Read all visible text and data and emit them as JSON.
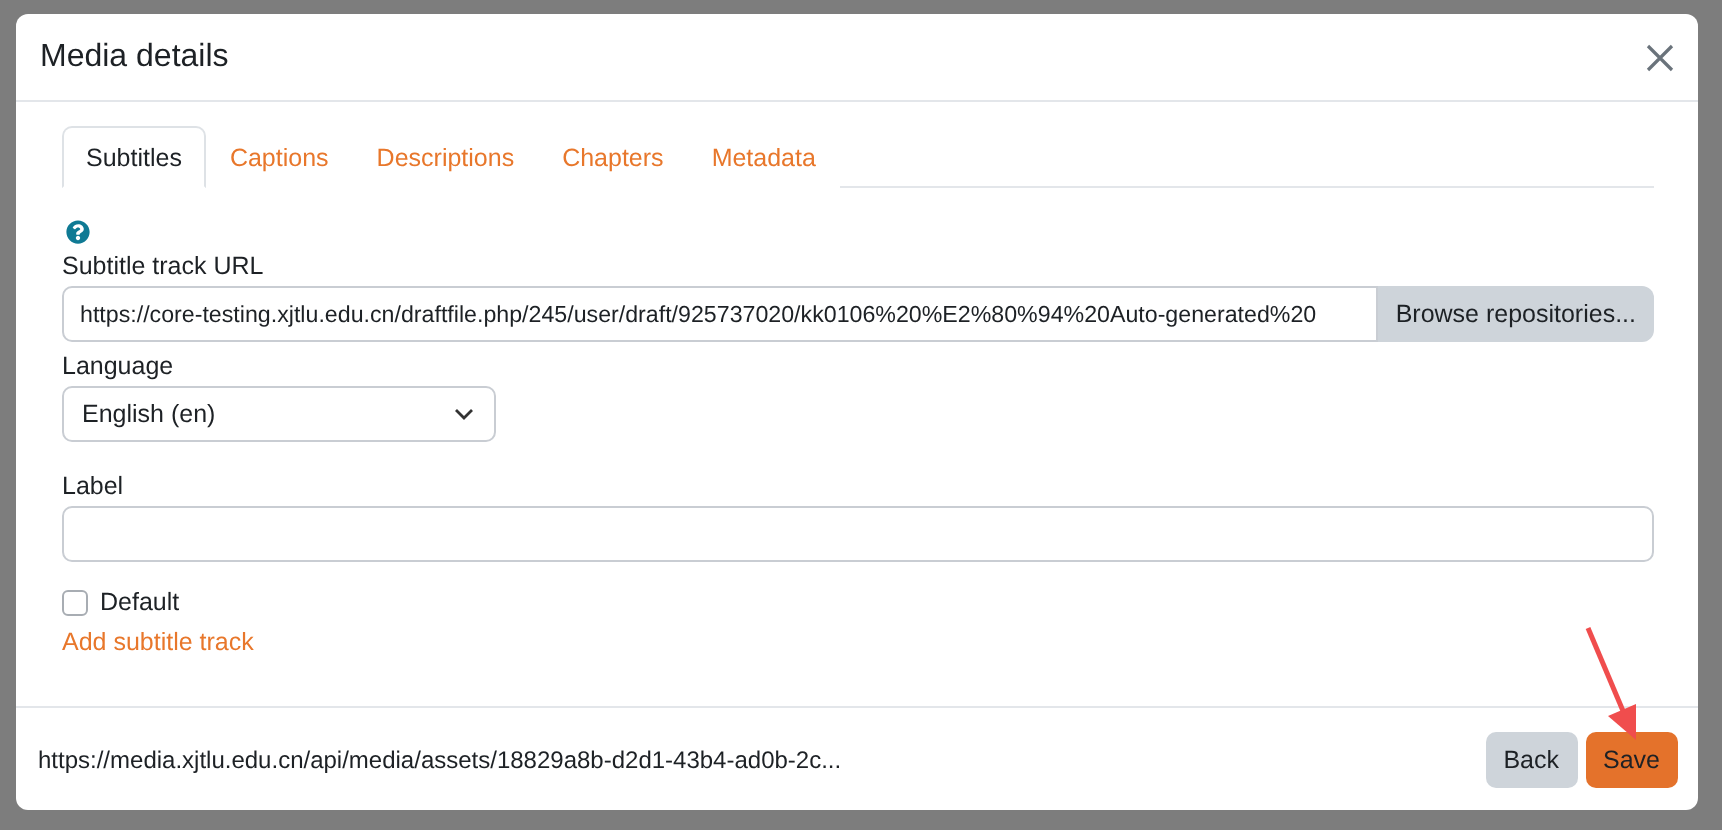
{
  "dialog": {
    "title": "Media details"
  },
  "tabs": [
    {
      "label": "Subtitles",
      "selected": true
    },
    {
      "label": "Captions",
      "selected": false
    },
    {
      "label": "Descriptions",
      "selected": false
    },
    {
      "label": "Chapters",
      "selected": false
    },
    {
      "label": "Metadata",
      "selected": false
    }
  ],
  "form": {
    "url_field": {
      "label": "Subtitle track URL",
      "value": "https://core-testing.xjtlu.edu.cn/draftfile.php/245/user/draft/925737020/kk0106%20%E2%80%94%20Auto-generated%20",
      "button": "Browse repositories..."
    },
    "language_field": {
      "label": "Language",
      "value": "English (en)"
    },
    "label_field": {
      "label": "Label"
    },
    "default_checkbox": {
      "label": "Default",
      "checked": false
    },
    "add_link": "Add subtitle track"
  },
  "footer": {
    "source_url": "https://media.xjtlu.edu.cn/api/media/assets/18829a8b-d2d1-43b4-ad0b-2c...",
    "buttons": [
      {
        "label": "Back",
        "kind": "secondary"
      },
      {
        "label": "Save",
        "kind": "primary"
      }
    ]
  }
}
